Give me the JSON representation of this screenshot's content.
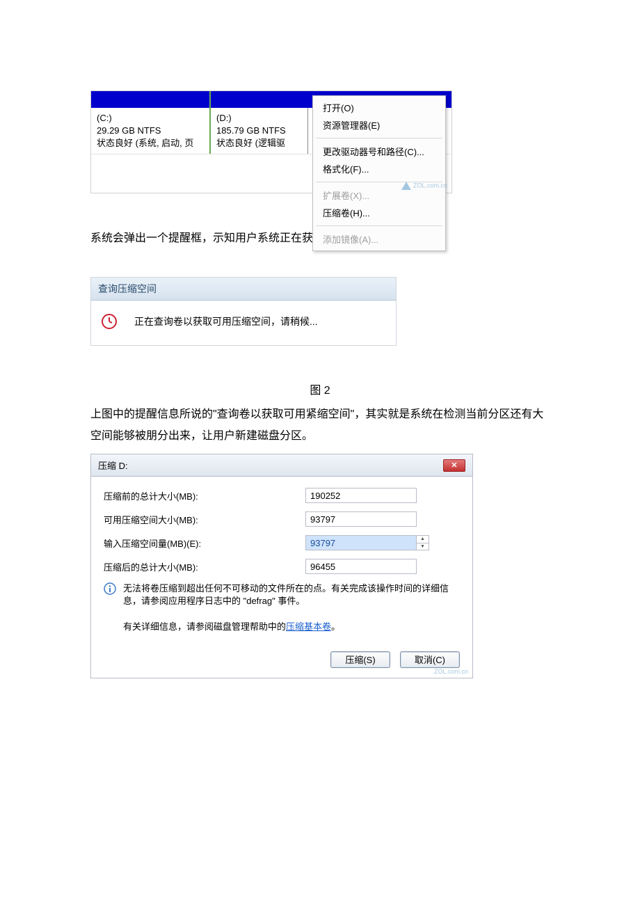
{
  "shot1": {
    "partC": {
      "letter": "(C:)",
      "size": "29.29 GB NTFS",
      "status": "状态良好 (系统, 启动, 页"
    },
    "partD": {
      "letter": "(D:)",
      "size": "185.79 GB NTFS",
      "status": "状态良好 (逻辑驱"
    },
    "menu": {
      "open": "打开(O)",
      "explorer": "资源管理器(E)",
      "changeLetter": "更改驱动器号和路径(C)...",
      "format": "格式化(F)...",
      "extend": "扩展卷(X)...",
      "shrink": "压缩卷(H)...",
      "mirror": "添加镜像(A)..."
    },
    "watermark": "ZOL.com.cn"
  },
  "para1": "系统会弹出一个提醒框，示知用户系统正在获取能够紧缩的空间。",
  "shot2": {
    "title": "查询压缩空间",
    "msg": "正在查询卷以获取可用压缩空间，请稍候..."
  },
  "figcap": "图 2",
  "para2": "上图中的提醒信息所说的\"查询卷以获取可用紧缩空间\"，其实就是系统在检测当前分区还有大空间能够被朋分出来，让用户新建磁盘分区。",
  "shot3": {
    "title": "压缩 D:",
    "rows": {
      "before": {
        "label": "压缩前的总计大小(MB):",
        "value": "190252"
      },
      "avail": {
        "label": "可用压缩空间大小(MB):",
        "value": "93797"
      },
      "input": {
        "label": "输入压缩空间量(MB)(E):",
        "value": "93797"
      },
      "after": {
        "label": "压缩后的总计大小(MB):",
        "value": "96455"
      }
    },
    "info": "无法将卷压缩到超出任何不可移动的文件所在的点。有关完成该操作时间的详细信息，请参阅应用程序日志中的 \"defrag\" 事件。",
    "helpPrefix": "有关详细信息，请参阅磁盘管理帮助中的",
    "helpLink": "压缩基本卷",
    "helpSuffix": "。",
    "shrinkBtn": "压缩(S)",
    "cancelBtn": "取消(C)",
    "watermark": "ZOL.com.cn"
  }
}
